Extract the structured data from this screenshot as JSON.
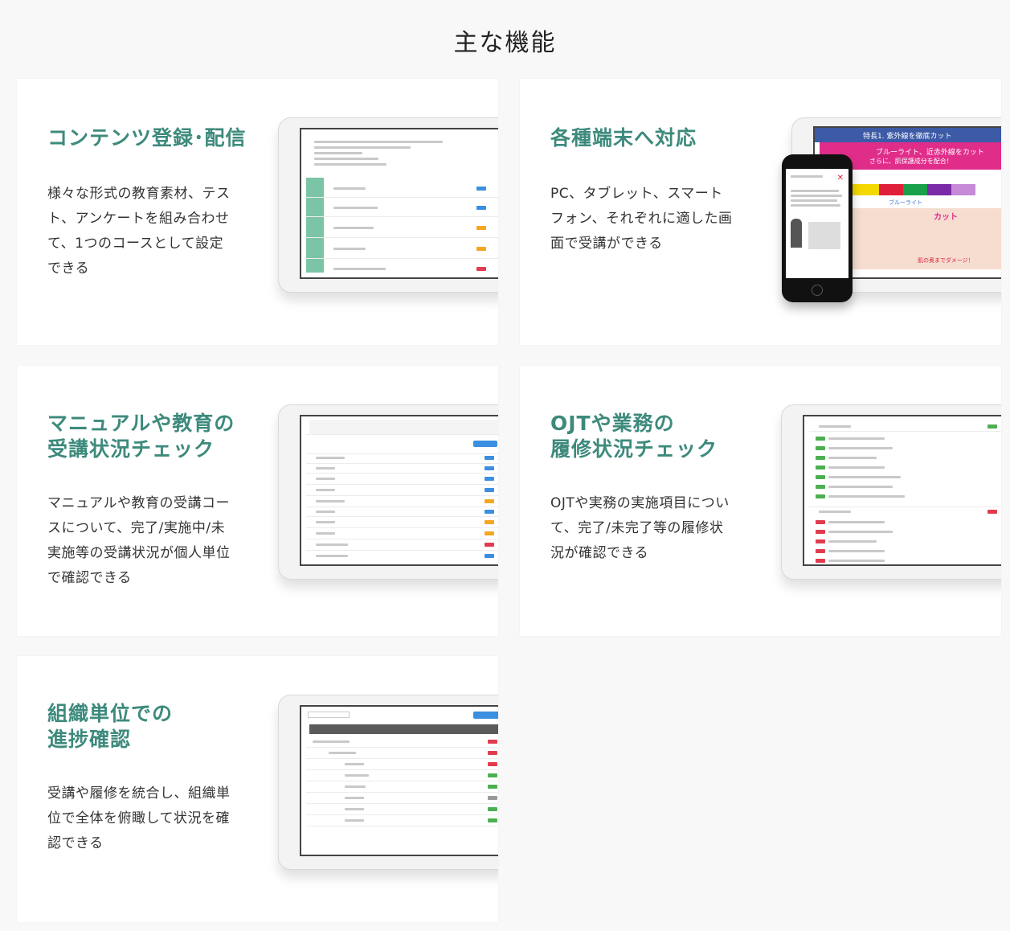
{
  "page": {
    "title": "主な機能"
  },
  "features": [
    {
      "title_lines": [
        "コンテンツ登録･配信"
      ],
      "desc": "様々な形式の教育素材、テスト、アンケートを組み合わせて、1つのコースとして設定できる"
    },
    {
      "title_lines": [
        "各種端末へ対応"
      ],
      "desc": "PC、タブレット、スマートフォン、それぞれに適した画面で受講ができる"
    },
    {
      "title_lines": [
        "マニュアルや教育の",
        "受講状況チェック"
      ],
      "desc": "マニュアルや教育の受講コースについて、完了/実施中/未実施等の受講状況が個人単位で確認できる"
    },
    {
      "title_lines": [
        "OJTや業務の",
        "履修状況チェック"
      ],
      "desc": "OJTや実務の実施項目について、完了/未完了等の履修状況が確認できる"
    },
    {
      "title_lines": [
        "組織単位での",
        "進捗確認"
      ],
      "desc": "受講や履修を統合し、組織単位で全体を俯瞰して状況を確認できる"
    }
  ],
  "tablet_screen": {
    "banner_title": "特長1. 紫外線を徹底カット",
    "banner_sub": "ブルーライト、近赤外線をカット",
    "banner_sub2": "さらに、肌保護成分を配合！",
    "label_blue": "ブルーライト",
    "label_cut": "カット",
    "label_damage": "肌の奥までダメージ！"
  },
  "colors": {
    "accent": "#3d8a7c",
    "badge_blue": "#3a8fe0",
    "badge_orange": "#f5a623",
    "badge_red": "#e23b4e",
    "badge_green": "#4caf50",
    "sidebar_green": "#7cc4a6"
  }
}
